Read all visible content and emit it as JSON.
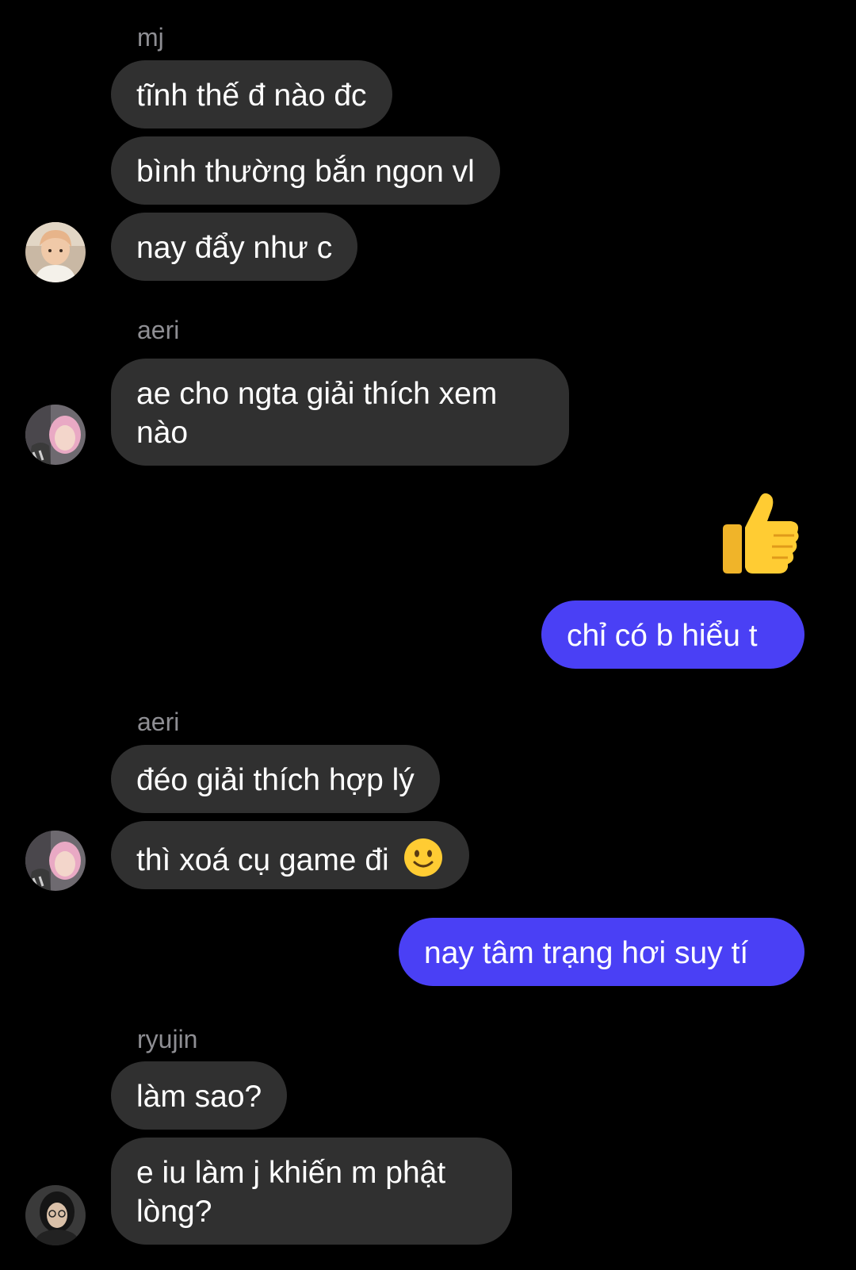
{
  "messages": {
    "g1": {
      "sender": "mj",
      "m1": "tĩnh thế đ nào đc",
      "m2": "bình thường bắn ngon vl",
      "m3": "nay đẩy như c"
    },
    "g2": {
      "sender": "aeri",
      "m1": "ae cho ngta giải thích xem nào"
    },
    "me1": {
      "reaction": "thumbs-up-icon",
      "m1": "chỉ có b hiểu t"
    },
    "g3": {
      "sender": "aeri",
      "m1": "đéo giải thích hợp lý",
      "m2": "thì xoá cụ game đi",
      "m2_emoji": "slightly-smiling-face-icon"
    },
    "me2": {
      "m1": "nay tâm trạng hơi suy tí"
    },
    "g4": {
      "sender": "ryujin",
      "m1": "làm sao?",
      "m2": "e iu làm j khiến m phật lòng?"
    }
  },
  "colors": {
    "background": "#000000",
    "incoming_bubble": "#303030",
    "outgoing_bubble": "#4a40f5",
    "sender_text": "#8e8e93"
  }
}
